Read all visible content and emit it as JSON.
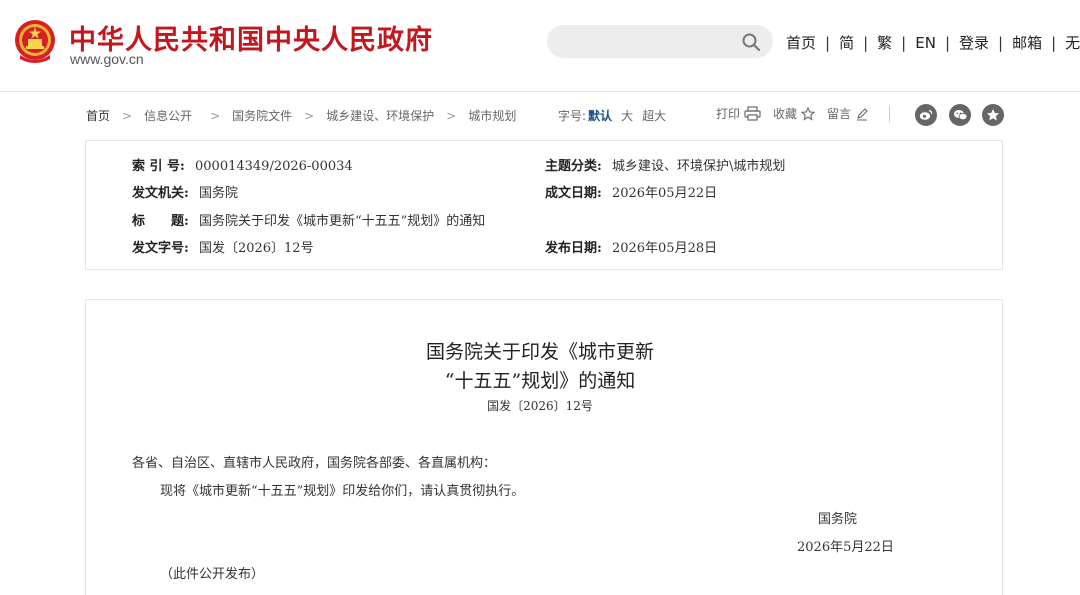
{
  "header": {
    "site_title": "中华人民共和国中央人民政府",
    "site_url": "www.gov.cn",
    "search_placeholder": "",
    "nav": [
      "首页",
      "简",
      "繁",
      "EN",
      "登录",
      "邮箱",
      "无障碍"
    ]
  },
  "breadcrumb": [
    "首页",
    "信息公开",
    "国务院文件",
    "城乡建设、环境保护",
    "城市规划"
  ],
  "font_size": {
    "label": "字号:",
    "options": [
      "默认",
      "大",
      "超大"
    ],
    "selected": "默认"
  },
  "tools": {
    "print": "打印",
    "favorite": "收藏",
    "comment": "留言"
  },
  "share_icons": [
    "weibo-icon",
    "wechat-icon",
    "qzone-icon"
  ],
  "meta": {
    "index_label": "索 引 号:",
    "index_value": "000014349/2026-00034",
    "category_label": "主题分类:",
    "category_value": "城乡建设、环境保护\\城市规划",
    "issuer_label": "发文机关:",
    "issuer_value": "国务院",
    "written_label": "成文日期:",
    "written_value": "2026年05月22日",
    "title_label": "标　　题:",
    "title_value": "国务院关于印发《城市更新“十五五”规划》的通知",
    "docno_label": "发文字号:",
    "docno_value": "国发〔2026〕12号",
    "published_label": "发布日期:",
    "published_value": "2026年05月28日"
  },
  "document": {
    "title_line1": "国务院关于印发《城市更新",
    "title_line2": "“十五五”规划》的通知",
    "doc_number": "国发〔2026〕12号",
    "addressees": "各省、自治区、直辖市人民政府，国务院各部委、各直属机构：",
    "body": "现将《城市更新“十五五”规划》印发给你们，请认真贯彻执行。",
    "signature": "国务院",
    "date": "2026年5月22日",
    "note": "（此件公开发布）"
  },
  "colors": {
    "brand_red": "#c4161c",
    "active_blue": "#1a4d8c"
  }
}
